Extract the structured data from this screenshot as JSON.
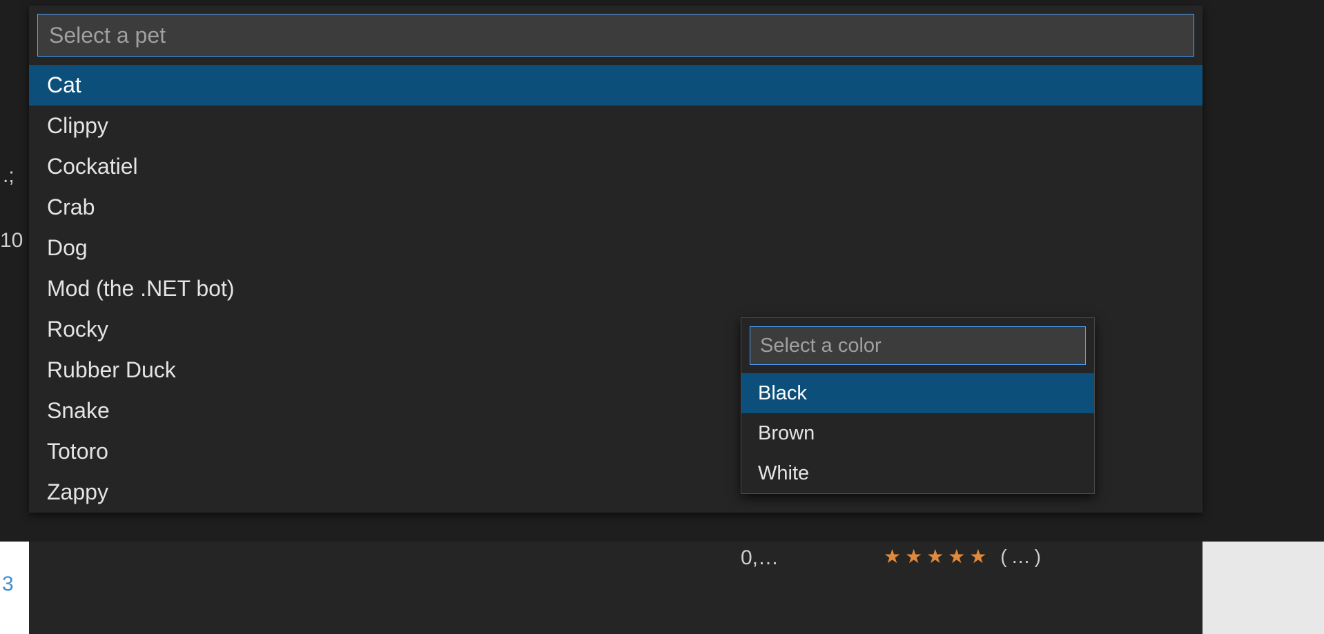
{
  "background": {
    "left_fragments": [
      ".;",
      "10"
    ],
    "left_blue_digit": "3",
    "downloads_fragment": "0,…",
    "stars": "★★★★★",
    "rating_tail": "(…)"
  },
  "pet_picker": {
    "placeholder": "Select a pet",
    "value": "",
    "selected_index": 0,
    "items": [
      "Cat",
      "Clippy",
      "Cockatiel",
      "Crab",
      "Dog",
      "Mod (the .NET bot)",
      "Rocky",
      "Rubber Duck",
      "Snake",
      "Totoro",
      "Zappy"
    ]
  },
  "color_picker": {
    "placeholder": "Select a color",
    "value": "",
    "selected_index": 0,
    "items": [
      "Black",
      "Brown",
      "White"
    ]
  },
  "colors": {
    "selection_bg": "#0b4f7a",
    "input_border": "#4aa3ff",
    "panel_bg": "#252526",
    "input_bg": "#3c3c3c"
  }
}
